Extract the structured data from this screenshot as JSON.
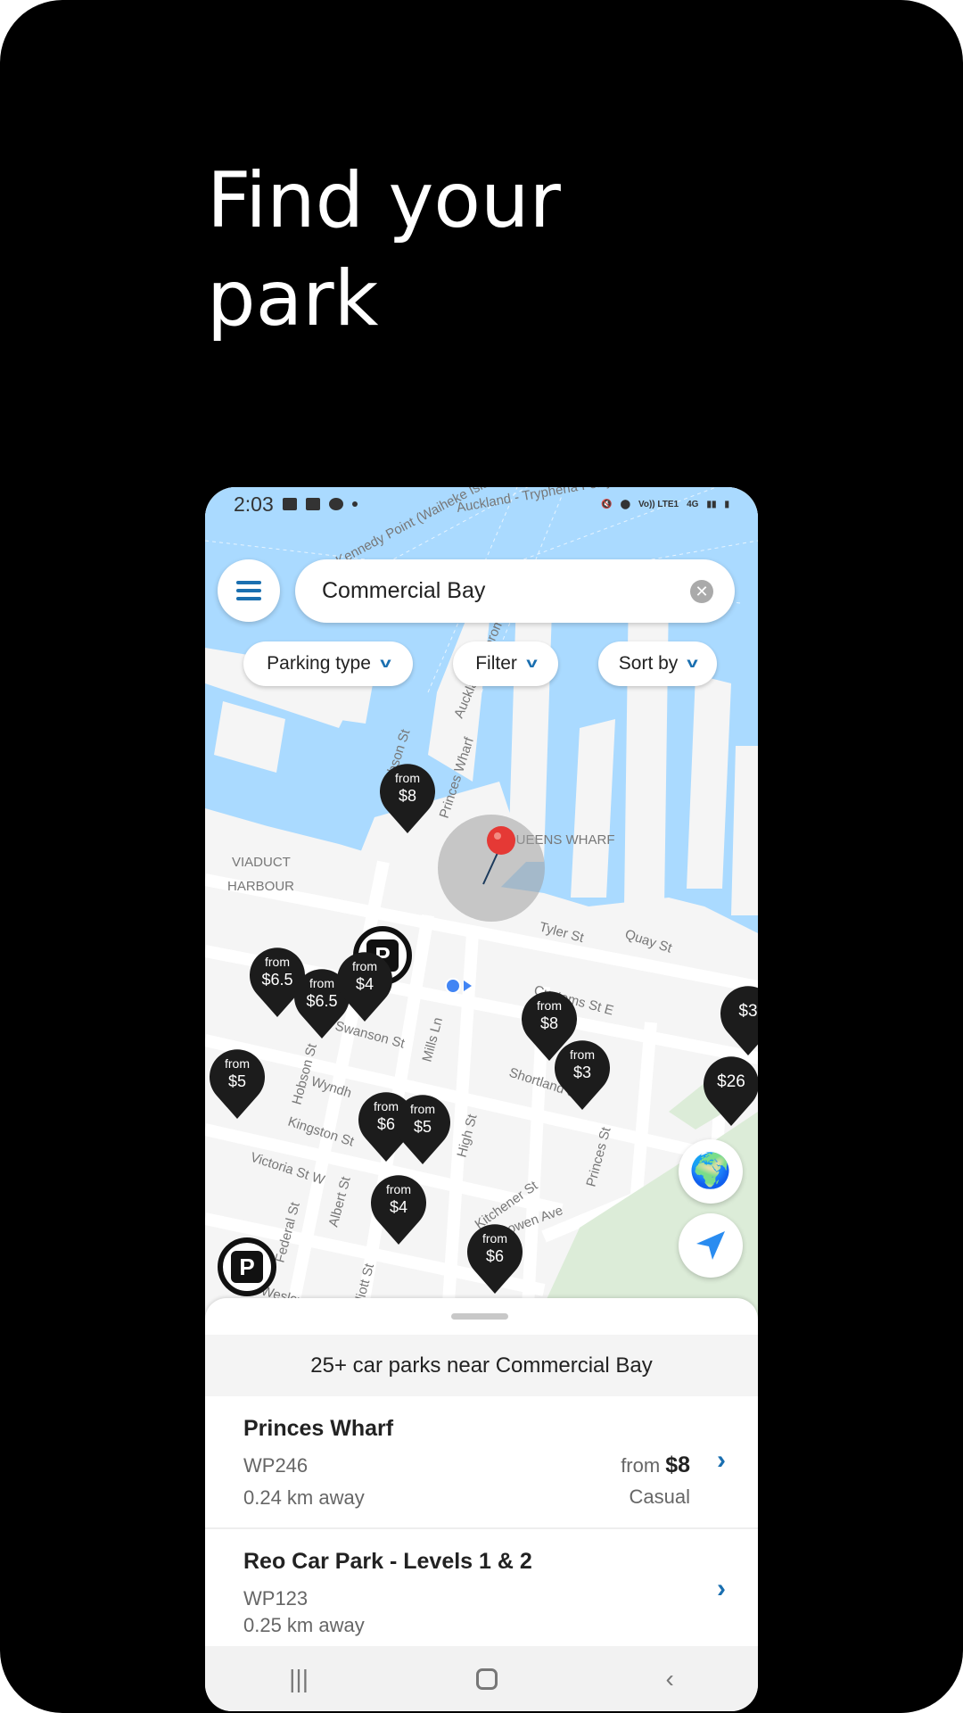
{
  "headline": {
    "line1": "Find your",
    "line2": "park"
  },
  "status_bar": {
    "time": "2:03",
    "network": "Vo)) LTE1",
    "net_type": "4G"
  },
  "search": {
    "value": "Commercial Bay",
    "clear_icon": "close-icon"
  },
  "filters": [
    {
      "label": "Parking type"
    },
    {
      "label": "Filter"
    },
    {
      "label": "Sort by"
    }
  ],
  "map": {
    "labels": {
      "viaduct1": "VIADUCT",
      "viaduct2": "HARBOUR",
      "queens": "QUEENS WHARF",
      "princes_wharf": "Princes Wharf",
      "coromandel": "Auckland - Coromandel",
      "kennedy": "Kennedy Point (Waiheke Isla",
      "tryphena": "Auckland - Tryphena Ferry",
      "tyler": "Tyler St",
      "quay": "Quay St",
      "customs": "Customs St E",
      "swanson": "Swanson St",
      "hobson": "Hobson St",
      "hobson2": "Hobson St",
      "mills": "Mills Ln",
      "shortland": "Shortland St",
      "wyndham": "Wyndh",
      "kingston": "Kingston St",
      "victoria": "Victoria St W",
      "federal": "Federal St",
      "albert": "Albert St",
      "elliott": "Elliott St",
      "high": "High St",
      "kitchener": "Kitchener St",
      "bowen": "Bowen Ave",
      "princes": "Princes St",
      "wesley": "Wesley"
    },
    "markers": [
      {
        "from": "from",
        "price": "$8"
      },
      {
        "from": "from",
        "price": "$6.5"
      },
      {
        "from": "from",
        "price": "$6.5"
      },
      {
        "from": "from",
        "price": "$4"
      },
      {
        "from": "from",
        "price": "$5"
      },
      {
        "from": "from",
        "price": "$8"
      },
      {
        "from": "from",
        "price": "$3"
      },
      {
        "from": "",
        "price": "$3"
      },
      {
        "from": "",
        "price": "$26"
      },
      {
        "from": "from",
        "price": "$6"
      },
      {
        "from": "from",
        "price": "$5"
      },
      {
        "from": "from",
        "price": "$4"
      },
      {
        "from": "from",
        "price": "$6"
      }
    ],
    "colors": {
      "water": "#aadaff",
      "land": "#f5f5f5",
      "park": "#dcecd8",
      "accent": "#1a6fb0",
      "pin": "#e53935"
    }
  },
  "sheet": {
    "header": "25+ car parks near Commercial Bay",
    "results": [
      {
        "name": "Princes Wharf",
        "code": "WP246",
        "distance": "0.24 km away",
        "from": "from",
        "price": "$8",
        "type": "Casual"
      },
      {
        "name": "Reo Car Park - Levels 1 & 2",
        "code": "WP123",
        "distance": "0.25 km away"
      }
    ]
  }
}
